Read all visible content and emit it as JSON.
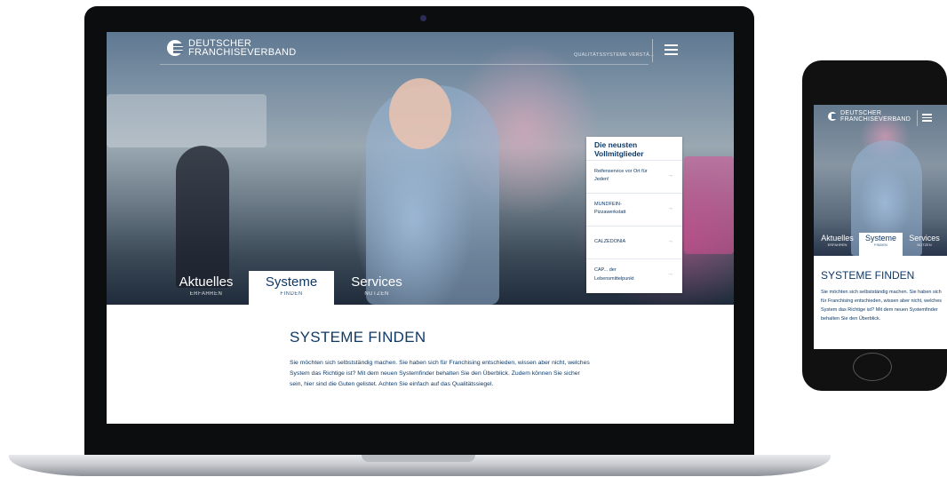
{
  "desktop": {
    "logo": {
      "line1": "DEUTSCHER",
      "line2": "FRANCHISEVERBAND"
    },
    "top_link": "QUALITÄTSSYSTEME VERSTÄ...",
    "tabs": [
      {
        "title": "Aktuelles",
        "subtitle": "ERFAHREN"
      },
      {
        "title": "Systeme",
        "subtitle": "FINDEN"
      },
      {
        "title": "Services",
        "subtitle": "NUTZEN"
      }
    ],
    "news": {
      "title_line1": "Die neusten",
      "title_line2": "Vollmitglieder",
      "items": [
        {
          "line1": "Reifenservice vor Ort für",
          "line2": "Jeden!"
        },
        {
          "line1": "MUNDFEIN-",
          "line2": "Pizzawerkstatt"
        },
        {
          "line1": "CALZEDONIA",
          "line2": ""
        },
        {
          "line1": "CAP... der",
          "line2": "Lebensmittelpunkt"
        }
      ],
      "arrow": "→"
    },
    "heading": "SYSTEME FINDEN",
    "body": "Sie möchten sich selbstständig machen. Sie haben sich für Franchising entschieden, wissen aber nicht, welches System das Richtige ist? Mit dem neuen Systemfinder behalten Sie den Überblick. Zudem können Sie sicher sein, hier sind die Guten gelistet. Achten Sie einfach auf das Qualitätssiegel."
  },
  "mobile": {
    "logo": {
      "line1": "DEUTSCHER",
      "line2": "FRANCHISEVERBAND"
    },
    "tabs": [
      {
        "title": "Aktuelles",
        "subtitle": "ERFAHREN"
      },
      {
        "title": "Systeme",
        "subtitle": "FINDEN"
      },
      {
        "title": "Services",
        "subtitle": "NUTZEN"
      }
    ],
    "heading": "SYSTEME FINDEN",
    "body": "Sie möchten sich selbstständig machen. Sie haben sich für Franchising entschieden, wissen aber nicht, welches System das Richtige ist? Mit dem neuen Systemfinder behalten Sie den Überblick."
  }
}
